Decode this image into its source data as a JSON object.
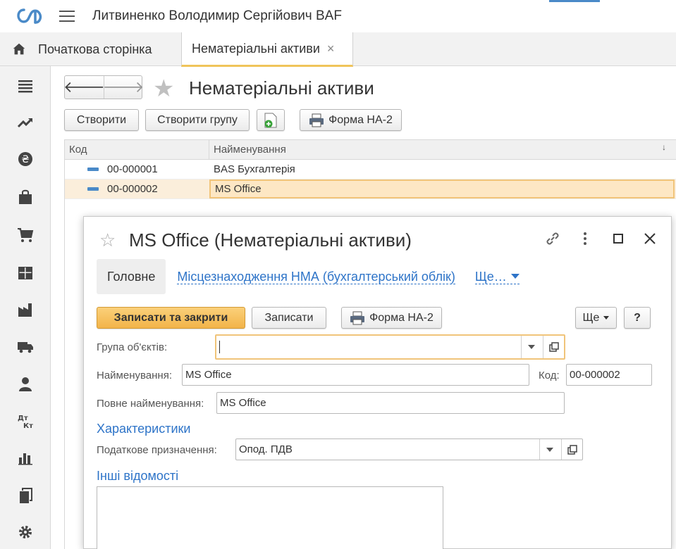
{
  "app": {
    "title": "Литвиненко Володимир Сергійович BAF"
  },
  "tabs": {
    "home_label": "Початкова сторінка",
    "active_label": "Нематеріальні активи",
    "close_glyph": "×"
  },
  "list": {
    "nav_back": "🡐",
    "nav_forward": "🡒",
    "title": "Нематеріальні активи",
    "toolbar": {
      "create": "Створити",
      "create_group": "Створити групу",
      "print_form": "Форма НА-2"
    },
    "columns": {
      "code": "Код",
      "name": "Найменування",
      "sort_glyph": "↓"
    },
    "rows": [
      {
        "code": "00-000001",
        "name": "BAS Бухгалтерія"
      },
      {
        "code": "00-000002",
        "name": "MS Office"
      }
    ]
  },
  "form": {
    "title": "MS Office (Нематеріальні активи)",
    "tabs": {
      "main": "Головне",
      "location": "Місцезнаходження НМА (бухгалтерський облік)",
      "more": "Ще…"
    },
    "toolbar": {
      "save_close": "Записати та закрити",
      "save": "Записати",
      "print_form": "Форма НА-2",
      "more": "Ще",
      "help": "?"
    },
    "fields": {
      "group_label": "Група об'єктів:",
      "group_value": "",
      "name_label": "Найменування:",
      "name_value": "MS Office",
      "code_label": "Код:",
      "code_value": "00-000002",
      "full_name_label": "Повне найменування:",
      "full_name_value": "MS Office",
      "tax_label": "Податкове призначення:",
      "tax_value": "Опод. ПДВ"
    },
    "sections": {
      "characteristics": "Характеристики",
      "other_info": "Інші відомості"
    }
  },
  "colors": {
    "accent_blue": "#2e74c8",
    "primary_button": "#f2b449",
    "selection": "#fde7c4",
    "logo": "#4a8ac8"
  }
}
